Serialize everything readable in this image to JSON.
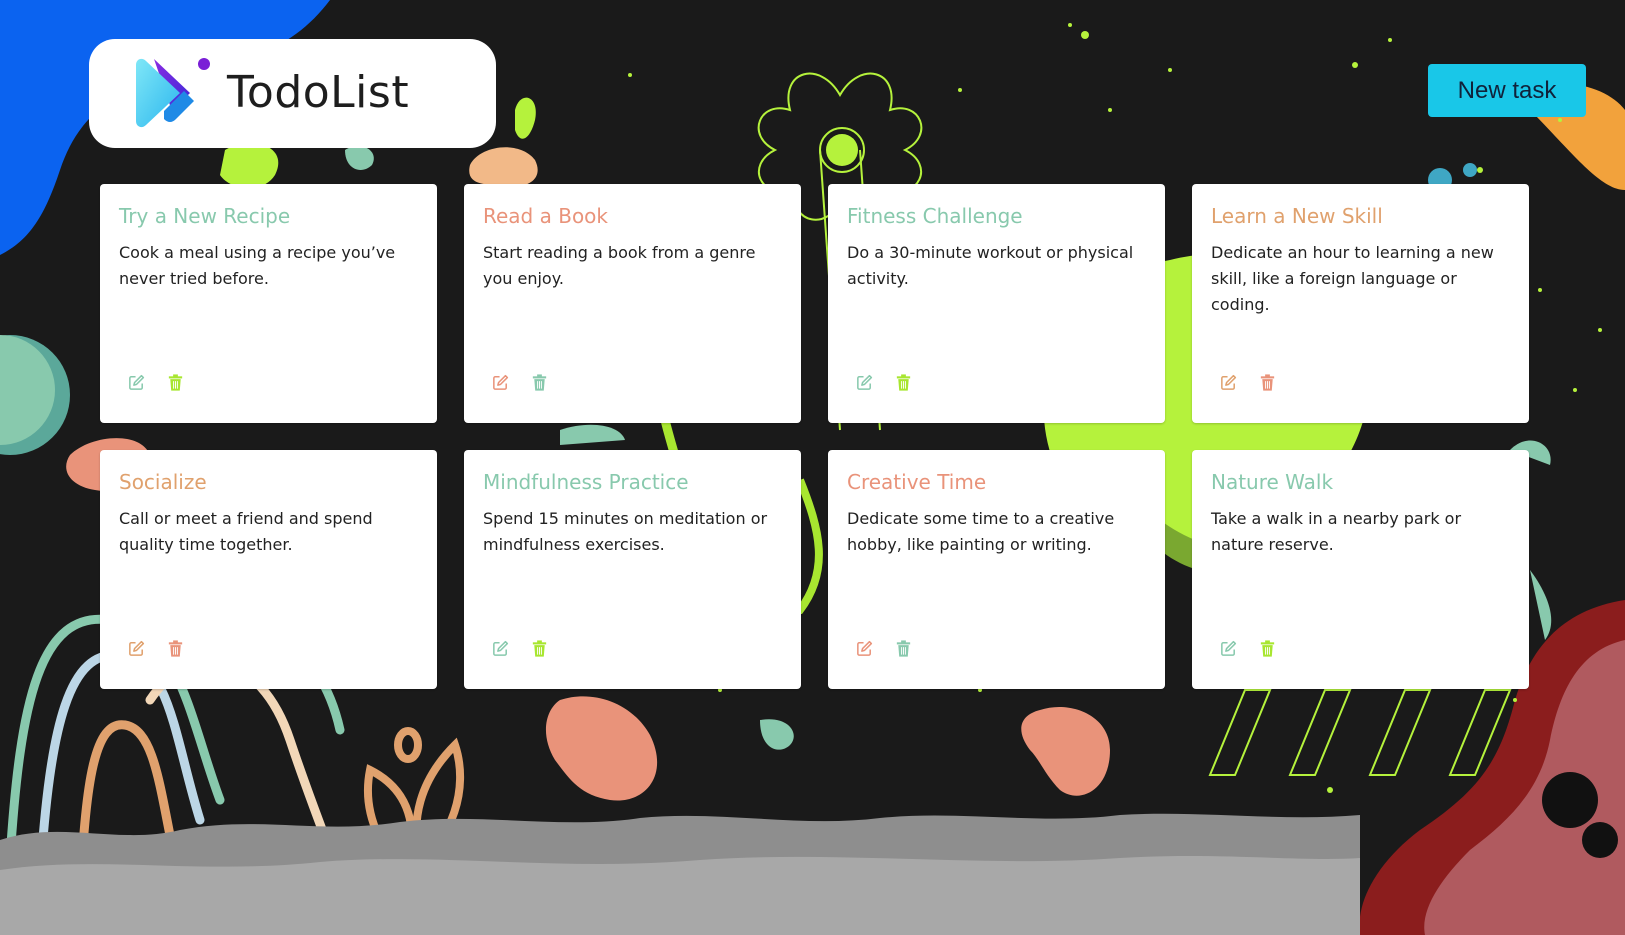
{
  "app": {
    "title": "TodoList",
    "new_task_label": "New task"
  },
  "colors": {
    "teal": "#88c9ad",
    "salmon": "#e9937a",
    "orange": "#e0a16d",
    "lime": "#a8e630",
    "button": "#19c7e8"
  },
  "tasks": [
    {
      "title": "Try a New Recipe",
      "description": "Cook a meal using a recipe you’ve never tried before.",
      "title_color": "#88c9ad",
      "edit_color": "#88c9ad",
      "delete_color": "#a8e630"
    },
    {
      "title": "Read a Book",
      "description": "Start reading a book from a genre you enjoy.",
      "title_color": "#e9937a",
      "edit_color": "#e9937a",
      "delete_color": "#88c9ad"
    },
    {
      "title": "Fitness Challenge",
      "description": "Do a 30-minute workout or physical activity.",
      "title_color": "#88c9ad",
      "edit_color": "#88c9ad",
      "delete_color": "#a8e630"
    },
    {
      "title": "Learn a New Skill",
      "description": "Dedicate an hour to learning a new skill, like a foreign language or coding.",
      "title_color": "#e0a16d",
      "edit_color": "#e0a16d",
      "delete_color": "#e9937a"
    },
    {
      "title": "Socialize",
      "description": "Call or meet a friend and spend quality time together.",
      "title_color": "#e0a16d",
      "edit_color": "#e0a16d",
      "delete_color": "#e9937a"
    },
    {
      "title": "Mindfulness Practice",
      "description": "Spend 15 minutes on meditation or mindfulness exercises.",
      "title_color": "#88c9ad",
      "edit_color": "#88c9ad",
      "delete_color": "#a8e630"
    },
    {
      "title": "Creative Time",
      "description": "Dedicate some time to a creative hobby, like painting or writing.",
      "title_color": "#e9937a",
      "edit_color": "#e9937a",
      "delete_color": "#88c9ad"
    },
    {
      "title": "Nature Walk",
      "description": "Take a walk in a nearby park or nature reserve.",
      "title_color": "#88c9ad",
      "edit_color": "#88c9ad",
      "delete_color": "#a8e630"
    }
  ],
  "icons": {
    "edit": "edit-icon",
    "delete": "trash-icon"
  }
}
